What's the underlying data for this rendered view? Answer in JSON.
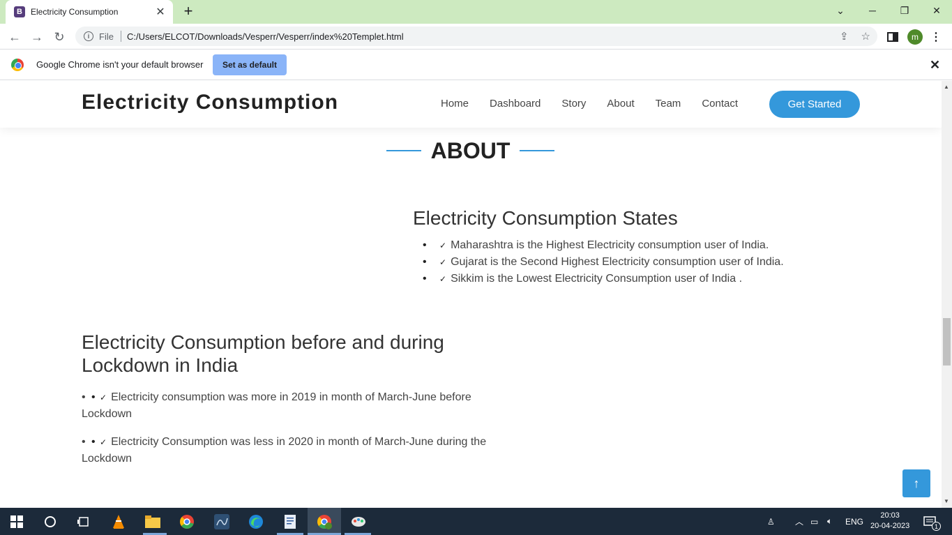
{
  "browser": {
    "tab_favicon": "B",
    "tab_title": "Electricity Consumption",
    "url_scheme": "File",
    "url": "C:/Users/ELCOT/Downloads/Vesperr/Vesperr/index%20Templet.html",
    "profile_initial": "m"
  },
  "infobar": {
    "message": "Google Chrome isn't your default browser",
    "button": "Set as default"
  },
  "site": {
    "logo": "Electricity Consumption",
    "nav": [
      "Home",
      "Dashboard",
      "Story",
      "About",
      "Team",
      "Contact"
    ],
    "cta": "Get Started",
    "accent_color": "#3498db"
  },
  "about": {
    "title": "ABOUT",
    "states": {
      "heading": "Electricity Consumption States",
      "items": [
        "Maharashtra is the Highest Electricity consumption user of India.",
        "Gujarat is the Second Highest Electricity consumption user of India.",
        "Sikkim is the Lowest Electricity Consumption user of India ."
      ]
    },
    "lockdown": {
      "heading": "Electricity Consumption before and during Lockdown in India",
      "items": [
        "Electricity consumption was more in 2019 in month of March-June before Lockdown",
        "Electricity Consumption was less in 2020 in month of March-June during the Lockdown"
      ]
    }
  },
  "taskbar": {
    "language": "ENG",
    "time": "20:03",
    "date": "20-04-2023",
    "notification_count": "1"
  }
}
